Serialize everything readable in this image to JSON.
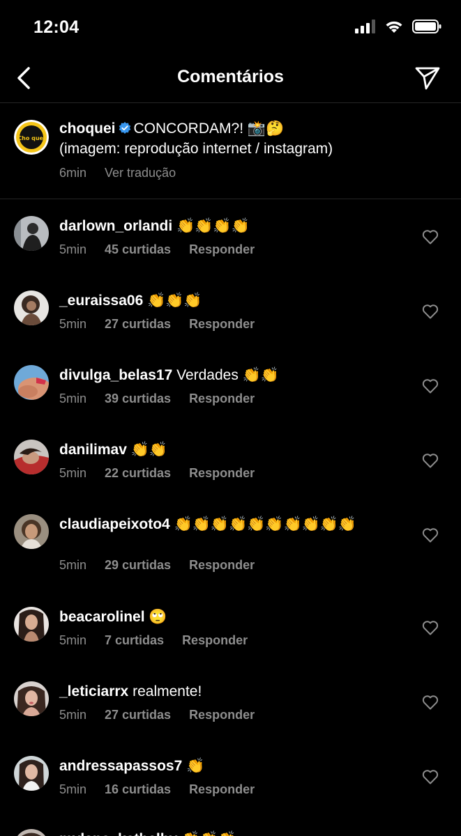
{
  "status": {
    "time": "12:04"
  },
  "header": {
    "title": "Comentários"
  },
  "caption": {
    "username": "choquei",
    "text": "CONCORDAM?! 📸🤔",
    "text2": "(imagem: reprodução internet / instagram)",
    "time": "6min",
    "translate": "Ver tradução",
    "avatar_text": "Cho quei"
  },
  "comments": [
    {
      "username": "darlown_orlandi",
      "text": "👏👏👏👏",
      "time": "5min",
      "likes": "45 curtidas",
      "reply": "Responder"
    },
    {
      "username": "_euraissa06",
      "text": "👏👏👏",
      "time": "5min",
      "likes": "27 curtidas",
      "reply": "Responder"
    },
    {
      "username": "divulga_belas17",
      "text": "Verdades 👏👏",
      "time": "5min",
      "likes": "39 curtidas",
      "reply": "Responder"
    },
    {
      "username": "danilimav",
      "text": "👏👏",
      "time": "5min",
      "likes": "22 curtidas",
      "reply": "Responder"
    },
    {
      "username": "claudiapeixoto4",
      "text": "👏👏👏👏👏👏👏👏👏👏",
      "time": "5min",
      "likes": "29 curtidas",
      "reply": "Responder"
    },
    {
      "username": "beacarolinel",
      "text": "🙄",
      "time": "5min",
      "likes": "7 curtidas",
      "reply": "Responder"
    },
    {
      "username": "_leticiarrx",
      "text": "realmente!",
      "time": "5min",
      "likes": "27 curtidas",
      "reply": "Responder"
    },
    {
      "username": "andressapassos7",
      "text": "👏",
      "time": "5min",
      "likes": "16 curtidas",
      "reply": "Responder"
    },
    {
      "username": "mylena_kathelhy",
      "text": "👏👏👏",
      "time": "",
      "likes": "",
      "reply": ""
    }
  ],
  "colors": {
    "background": "#000000",
    "muted": "#8e8e8e",
    "verified": "#3897f0",
    "divider": "#262626",
    "brand_yellow": "#f5c518"
  }
}
